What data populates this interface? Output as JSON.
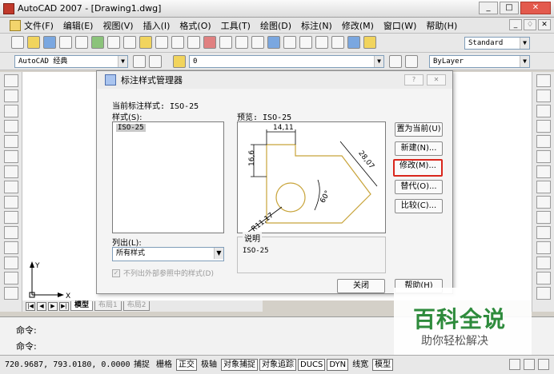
{
  "window": {
    "title": "AutoCAD 2007 - [Drawing1.dwg]",
    "controls": [
      "_",
      "□",
      "✕"
    ]
  },
  "menubar": {
    "items": [
      "文件(F)",
      "编辑(E)",
      "视图(V)",
      "插入(I)",
      "格式(O)",
      "工具(T)",
      "绘图(D)",
      "标注(N)",
      "修改(M)",
      "窗口(W)",
      "帮助(H)"
    ],
    "mdi_controls": [
      "_",
      "♢",
      "✕"
    ]
  },
  "toolbar": {
    "text_style": "Standard",
    "workspace": "AutoCAD 经典",
    "layer": "0",
    "bylayer": "ByLayer"
  },
  "dialog": {
    "title": "标注样式管理器",
    "current_style_label": "当前标注样式: ISO-25",
    "styles_label": "样式(S):",
    "styles": [
      "ISO-25"
    ],
    "preview_label": "预览: ISO-25",
    "list_label": "列出(L):",
    "list_value": "所有样式",
    "checkbox_label": "不列出外部参照中的样式(D)",
    "description_label": "说明",
    "description_value": "ISO-25",
    "buttons": {
      "set_current": "置为当前(U)",
      "new": "新建(N)...",
      "modify": "修改(M)...",
      "override": "替代(O)...",
      "compare": "比较(C)...",
      "close": "关闭",
      "help": "帮助(H)"
    },
    "preview_dims": {
      "top": "14,11",
      "left": "16,6",
      "diag": "28,07",
      "angle": "60°",
      "radius": "R11,17"
    }
  },
  "layout_tabs": [
    "模型",
    "布局1",
    "布局2"
  ],
  "command": {
    "prompt1": "命令:",
    "prompt2": "命令:"
  },
  "status": {
    "coords": "720.9687, 793.0180, 0.0000",
    "toggles": [
      "捕捉",
      "栅格",
      "正交",
      "极轴",
      "对象捕捉",
      "对象追踪",
      "DUCS",
      "DYN",
      "线宽",
      "模型"
    ],
    "toggles_on": [
      "正交",
      "对象捕捉",
      "对象追踪",
      "DUCS",
      "DYN",
      "模型"
    ]
  },
  "ucs": {
    "x_label": "X",
    "y_label": "Y"
  },
  "watermark": {
    "line1": "百科全说",
    "line2": "助你轻松解决"
  }
}
